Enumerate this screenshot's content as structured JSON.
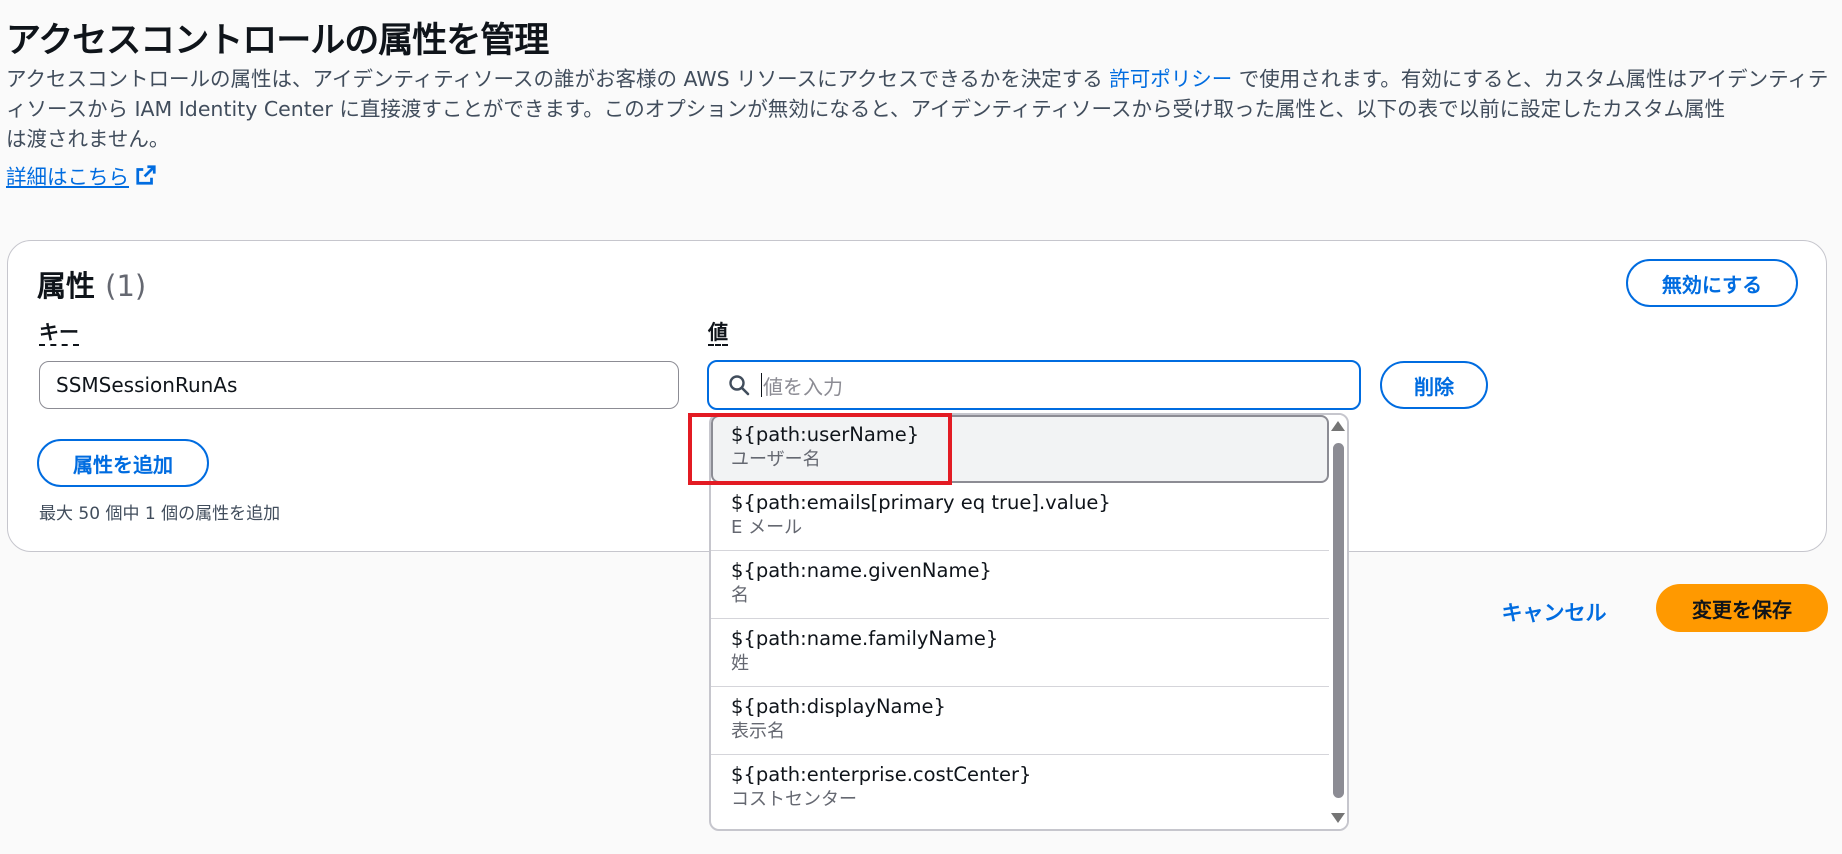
{
  "page": {
    "title": "アクセスコントロールの属性を管理",
    "description_line1_prefix": "アクセスコントロールの属性は、アイデンティティソースの誰がお客様の AWS リソースにアクセスできるかを決定する ",
    "description_link": "許可ポリシー",
    "description_line1_suffix": " で使用されます。有効にすると、カスタム属性はアイデン",
    "description_line2": "ティティソースから IAM Identity Center に直接渡すことができます。このオプションが無効になると、アイデンティティソースから受け取った属性と、以下の表で以前に設定したカスタム属性",
    "description_line3": "は渡されません。",
    "learn_more": "詳細はこちら"
  },
  "card": {
    "title": "属性",
    "count": "(1)",
    "disable_button": "無効にする",
    "key_label": "キー",
    "value_label": "値",
    "key_value": "SSMSessionRunAs",
    "value_placeholder": "値を入力",
    "delete_button": "削除",
    "add_button": "属性を追加",
    "max_note": "最大 50 個中 1 個の属性を追加"
  },
  "dropdown": {
    "options": [
      {
        "value": "${path:userName}",
        "desc": "ユーザー名"
      },
      {
        "value": "${path:emails[primary eq true].value}",
        "desc": "E メール"
      },
      {
        "value": "${path:name.givenName}",
        "desc": "名"
      },
      {
        "value": "${path:name.familyName}",
        "desc": "姓"
      },
      {
        "value": "${path:displayName}",
        "desc": "表示名"
      },
      {
        "value": "${path:enterprise.costCenter}",
        "desc": "コストセンター"
      }
    ],
    "highlighted_index": 0
  },
  "footer": {
    "cancel_button": "キャンセル",
    "save_button": "変更を保存"
  },
  "colors": {
    "link": "#006ce0",
    "primary": "#ff9900",
    "annotation": "#e31b23"
  },
  "icons": {
    "learn_more": "external-link-icon",
    "value_input": "search-icon"
  }
}
